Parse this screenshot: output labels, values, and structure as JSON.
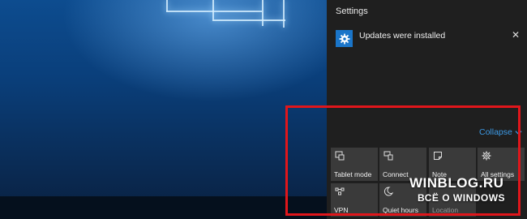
{
  "action_center": {
    "title": "Settings",
    "notification": {
      "text": "Updates were installed",
      "icon": "gear-icon"
    },
    "collapse_label": "Collapse"
  },
  "quick_actions": [
    {
      "label": "Tablet mode",
      "icon": "tablet-mode-icon"
    },
    {
      "label": "Connect",
      "icon": "connect-icon"
    },
    {
      "label": "Note",
      "icon": "note-icon"
    },
    {
      "label": "All settings",
      "icon": "gear-icon"
    },
    {
      "label": "VPN",
      "icon": "vpn-icon"
    },
    {
      "label": "Quiet hours",
      "icon": "moon-icon"
    },
    {
      "label": "Location",
      "icon": "location-icon"
    }
  ],
  "watermark": {
    "line1": "WINBLOG.RU",
    "line2": "ВСЁ О WINDOWS"
  },
  "colors": {
    "accent": "#1a75c9",
    "link": "#3c9ae6",
    "highlight": "#e0161b",
    "tile": "#3a3a3a",
    "panel": "#1f1f1f"
  }
}
